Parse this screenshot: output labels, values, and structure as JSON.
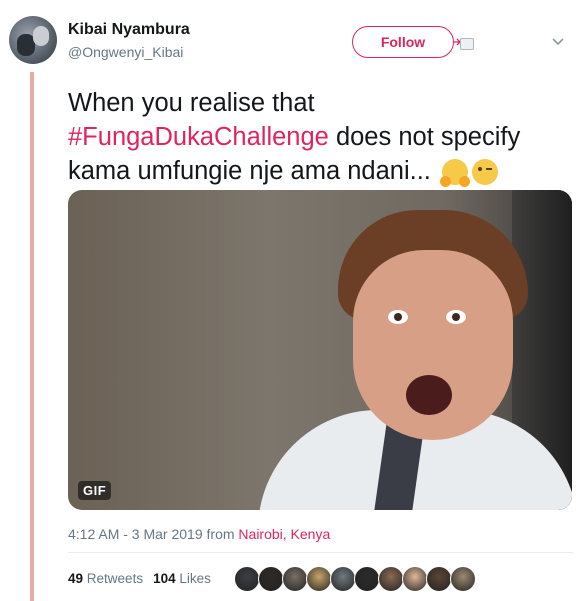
{
  "author": {
    "name": "Kibai Nyambura",
    "handle": "@Ongwenyi_Kibai"
  },
  "actions": {
    "follow_label": "Follow"
  },
  "tweet": {
    "text_before": "When you realise that ",
    "hashtag": "#FungaDukaChallenge",
    "text_after": " does not specify kama umfungie nje ama ndani...",
    "emojis": [
      "hugging-face",
      "winking-face"
    ]
  },
  "media": {
    "badge": "GIF"
  },
  "meta": {
    "time": "4:12 AM - 3 Mar 2019",
    "from": " from ",
    "location": "Nairobi, Kenya"
  },
  "stats": {
    "retweets_count": "49",
    "retweets_label": "Retweets",
    "likes_count": "104",
    "likes_label": "Likes"
  },
  "likers": {
    "count": 10,
    "colors": [
      "#3b3f44",
      "#2f2a26",
      "#7a6f63",
      "#c9a46b",
      "#6f7a80",
      "#2b2b2b",
      "#8a6a52",
      "#e2b79a",
      "#5a4634",
      "#9c8a70"
    ]
  },
  "colors": {
    "accent": "#e0245e",
    "text": "#14171a",
    "muted": "#657786",
    "thread_bar": "#e8a9a9"
  }
}
